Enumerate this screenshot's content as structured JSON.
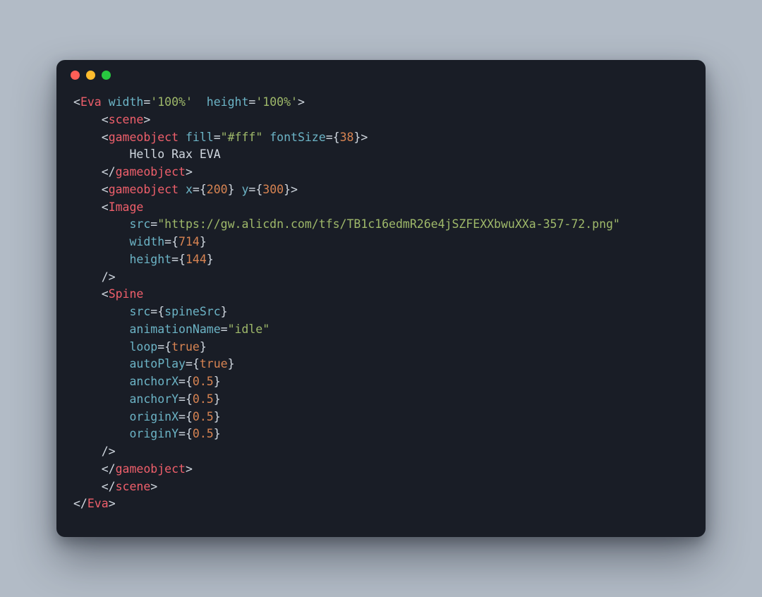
{
  "traffic": {
    "red": "#ff5f57",
    "yellow": "#febc2e",
    "green": "#28c840"
  },
  "tokens": {
    "l1": {
      "tag": "Eva",
      "a1": "width",
      "v1": "'100%'",
      "a2": "height",
      "v2": "'100%'"
    },
    "l2": {
      "tag": "scene"
    },
    "l3": {
      "tag": "gameobject",
      "a1": "fill",
      "v1": "\"#fff\"",
      "a2": "fontSize",
      "n2": "38"
    },
    "l4": {
      "text": "Hello Rax EVA"
    },
    "l5": {
      "tag": "gameobject"
    },
    "l6": {
      "tag": "gameobject",
      "a1": "x",
      "n1": "200",
      "a2": "y",
      "n2": "300"
    },
    "l7": {
      "tag": "Image"
    },
    "l8": {
      "a": "src",
      "v": "\"https://gw.alicdn.com/tfs/TB1c16edmR26e4jSZFEXXbwuXXa-357-72.png\""
    },
    "l9": {
      "a": "width",
      "n": "714"
    },
    "l10": {
      "a": "height",
      "n": "144"
    },
    "l12": {
      "tag": "Spine"
    },
    "l13": {
      "a": "src",
      "id": "spineSrc"
    },
    "l14": {
      "a": "animationName",
      "v": "\"idle\""
    },
    "l15": {
      "a": "loop",
      "kw": "true"
    },
    "l16": {
      "a": "autoPlay",
      "kw": "true"
    },
    "l17": {
      "a": "anchorX",
      "n": "0.5"
    },
    "l18": {
      "a": "anchorY",
      "n": "0.5"
    },
    "l19": {
      "a": "originX",
      "n": "0.5"
    },
    "l20": {
      "a": "originY",
      "n": "0.5"
    },
    "l22": {
      "tag": "gameobject"
    },
    "l23": {
      "tag": "scene"
    },
    "l24": {
      "tag": "Eva"
    }
  }
}
